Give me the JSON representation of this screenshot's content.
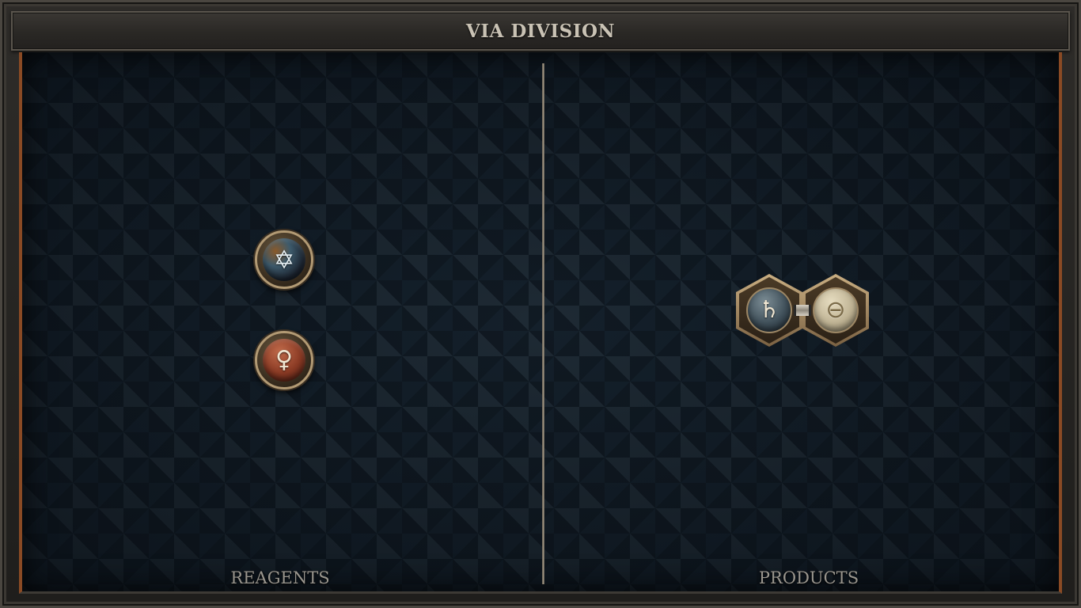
{
  "title": "VIA DIVISION",
  "reagents_label": "REAGENTS",
  "products_label": "PRODUCTS",
  "reagents": [
    {
      "element": "quintessence",
      "symbol": "✡",
      "icon": "quintessence-icon"
    },
    {
      "element": "copper",
      "symbol": "♀",
      "icon": "copper-icon"
    }
  ],
  "products": [
    {
      "element": "lead",
      "symbol": "♄",
      "icon": "lead-icon"
    },
    {
      "element": "salt",
      "symbol": "⊖",
      "icon": "salt-icon"
    }
  ],
  "colors": {
    "frame_accent": "#8a4a24",
    "title_text": "#c9c2b4",
    "label_text": "#9a968e"
  }
}
